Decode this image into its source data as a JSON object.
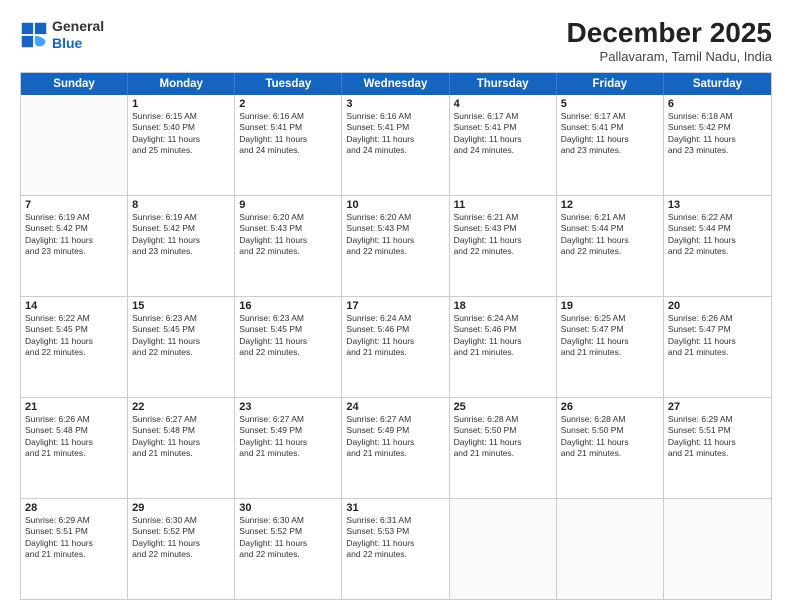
{
  "header": {
    "logo_line1": "General",
    "logo_line2": "Blue",
    "month_title": "December 2025",
    "location": "Pallavaram, Tamil Nadu, India"
  },
  "weekdays": [
    "Sunday",
    "Monday",
    "Tuesday",
    "Wednesday",
    "Thursday",
    "Friday",
    "Saturday"
  ],
  "rows": [
    [
      {
        "day": "",
        "info": ""
      },
      {
        "day": "1",
        "info": "Sunrise: 6:15 AM\nSunset: 5:40 PM\nDaylight: 11 hours\nand 25 minutes."
      },
      {
        "day": "2",
        "info": "Sunrise: 6:16 AM\nSunset: 5:41 PM\nDaylight: 11 hours\nand 24 minutes."
      },
      {
        "day": "3",
        "info": "Sunrise: 6:16 AM\nSunset: 5:41 PM\nDaylight: 11 hours\nand 24 minutes."
      },
      {
        "day": "4",
        "info": "Sunrise: 6:17 AM\nSunset: 5:41 PM\nDaylight: 11 hours\nand 24 minutes."
      },
      {
        "day": "5",
        "info": "Sunrise: 6:17 AM\nSunset: 5:41 PM\nDaylight: 11 hours\nand 23 minutes."
      },
      {
        "day": "6",
        "info": "Sunrise: 6:18 AM\nSunset: 5:42 PM\nDaylight: 11 hours\nand 23 minutes."
      }
    ],
    [
      {
        "day": "7",
        "info": "Sunrise: 6:19 AM\nSunset: 5:42 PM\nDaylight: 11 hours\nand 23 minutes."
      },
      {
        "day": "8",
        "info": "Sunrise: 6:19 AM\nSunset: 5:42 PM\nDaylight: 11 hours\nand 23 minutes."
      },
      {
        "day": "9",
        "info": "Sunrise: 6:20 AM\nSunset: 5:43 PM\nDaylight: 11 hours\nand 22 minutes."
      },
      {
        "day": "10",
        "info": "Sunrise: 6:20 AM\nSunset: 5:43 PM\nDaylight: 11 hours\nand 22 minutes."
      },
      {
        "day": "11",
        "info": "Sunrise: 6:21 AM\nSunset: 5:43 PM\nDaylight: 11 hours\nand 22 minutes."
      },
      {
        "day": "12",
        "info": "Sunrise: 6:21 AM\nSunset: 5:44 PM\nDaylight: 11 hours\nand 22 minutes."
      },
      {
        "day": "13",
        "info": "Sunrise: 6:22 AM\nSunset: 5:44 PM\nDaylight: 11 hours\nand 22 minutes."
      }
    ],
    [
      {
        "day": "14",
        "info": "Sunrise: 6:22 AM\nSunset: 5:45 PM\nDaylight: 11 hours\nand 22 minutes."
      },
      {
        "day": "15",
        "info": "Sunrise: 6:23 AM\nSunset: 5:45 PM\nDaylight: 11 hours\nand 22 minutes."
      },
      {
        "day": "16",
        "info": "Sunrise: 6:23 AM\nSunset: 5:45 PM\nDaylight: 11 hours\nand 22 minutes."
      },
      {
        "day": "17",
        "info": "Sunrise: 6:24 AM\nSunset: 5:46 PM\nDaylight: 11 hours\nand 21 minutes."
      },
      {
        "day": "18",
        "info": "Sunrise: 6:24 AM\nSunset: 5:46 PM\nDaylight: 11 hours\nand 21 minutes."
      },
      {
        "day": "19",
        "info": "Sunrise: 6:25 AM\nSunset: 5:47 PM\nDaylight: 11 hours\nand 21 minutes."
      },
      {
        "day": "20",
        "info": "Sunrise: 6:26 AM\nSunset: 5:47 PM\nDaylight: 11 hours\nand 21 minutes."
      }
    ],
    [
      {
        "day": "21",
        "info": "Sunrise: 6:26 AM\nSunset: 5:48 PM\nDaylight: 11 hours\nand 21 minutes."
      },
      {
        "day": "22",
        "info": "Sunrise: 6:27 AM\nSunset: 5:48 PM\nDaylight: 11 hours\nand 21 minutes."
      },
      {
        "day": "23",
        "info": "Sunrise: 6:27 AM\nSunset: 5:49 PM\nDaylight: 11 hours\nand 21 minutes."
      },
      {
        "day": "24",
        "info": "Sunrise: 6:27 AM\nSunset: 5:49 PM\nDaylight: 11 hours\nand 21 minutes."
      },
      {
        "day": "25",
        "info": "Sunrise: 6:28 AM\nSunset: 5:50 PM\nDaylight: 11 hours\nand 21 minutes."
      },
      {
        "day": "26",
        "info": "Sunrise: 6:28 AM\nSunset: 5:50 PM\nDaylight: 11 hours\nand 21 minutes."
      },
      {
        "day": "27",
        "info": "Sunrise: 6:29 AM\nSunset: 5:51 PM\nDaylight: 11 hours\nand 21 minutes."
      }
    ],
    [
      {
        "day": "28",
        "info": "Sunrise: 6:29 AM\nSunset: 5:51 PM\nDaylight: 11 hours\nand 21 minutes."
      },
      {
        "day": "29",
        "info": "Sunrise: 6:30 AM\nSunset: 5:52 PM\nDaylight: 11 hours\nand 22 minutes."
      },
      {
        "day": "30",
        "info": "Sunrise: 6:30 AM\nSunset: 5:52 PM\nDaylight: 11 hours\nand 22 minutes."
      },
      {
        "day": "31",
        "info": "Sunrise: 6:31 AM\nSunset: 5:53 PM\nDaylight: 11 hours\nand 22 minutes."
      },
      {
        "day": "",
        "info": ""
      },
      {
        "day": "",
        "info": ""
      },
      {
        "day": "",
        "info": ""
      }
    ]
  ]
}
